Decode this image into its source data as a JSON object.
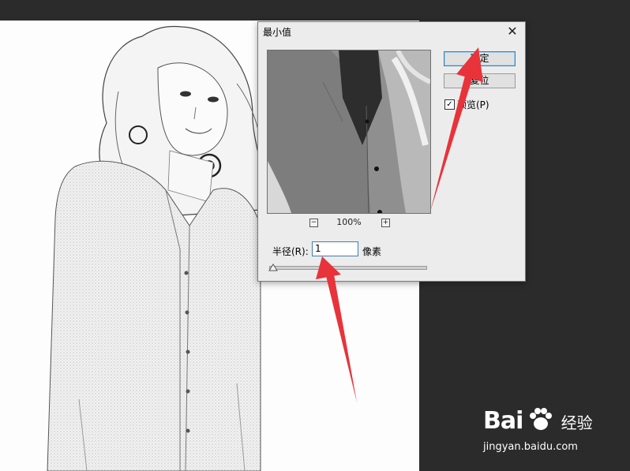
{
  "dialog": {
    "title": "最小值",
    "close_glyph": "✕",
    "preview": {
      "zoom": "100%",
      "zoom_out_glyph": "−",
      "zoom_in_glyph": "+"
    },
    "buttons": {
      "ok": "确定",
      "reset": "复位"
    },
    "preview_checkbox": {
      "label": "预览(P)",
      "checked": true,
      "check_glyph": "✓"
    },
    "radius": {
      "label": "半径(R):",
      "value": "1",
      "unit": "像素"
    }
  },
  "watermark": {
    "brand": "Bai",
    "jingyan": "经验",
    "url": "jingyan.baidu.com"
  },
  "colors": {
    "background": "#2b2b2b",
    "dialog": "#ececec",
    "accent": "#3c7fb1",
    "annotation": "#e8333b"
  }
}
